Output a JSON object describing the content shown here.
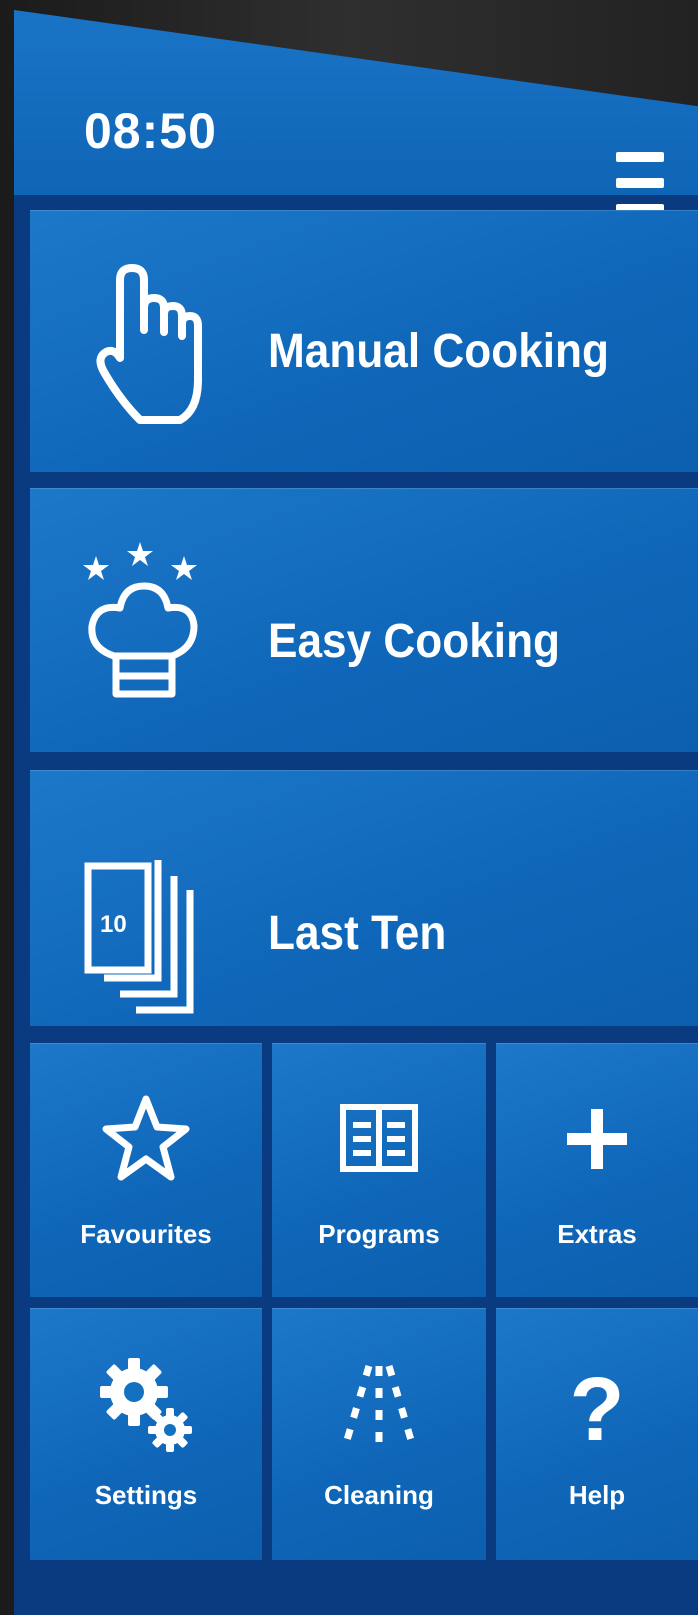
{
  "status_bar": {
    "time": "08:50",
    "menu_icon": "hamburger-menu-icon"
  },
  "main_tiles": [
    {
      "label": "Manual Cooking",
      "icon": "hand-pointer-icon"
    },
    {
      "label": "Easy Cooking",
      "icon": "chef-hat-stars-icon"
    },
    {
      "label": "Last Ten",
      "icon": "stacked-cards-ten-icon",
      "icon_text": "10"
    }
  ],
  "grid_tiles": [
    {
      "label": "Favourites",
      "icon": "star-icon"
    },
    {
      "label": "Programs",
      "icon": "book-icon"
    },
    {
      "label": "Extras",
      "icon": "plus-icon"
    },
    {
      "label": "Settings",
      "icon": "gears-icon"
    },
    {
      "label": "Cleaning",
      "icon": "spray-icon"
    },
    {
      "label": "Help",
      "icon": "question-mark-icon",
      "icon_text": "?"
    }
  ],
  "colors": {
    "tile_blue": "#1a72c4",
    "frame_blue": "#0a3a80",
    "text": "#ffffff"
  }
}
